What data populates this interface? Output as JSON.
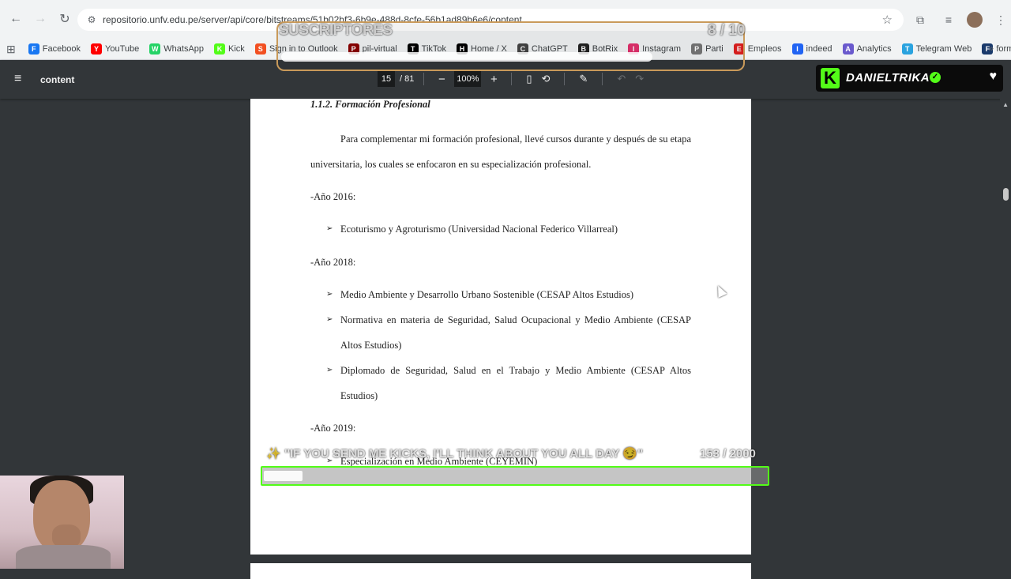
{
  "browser": {
    "url": "repositorio.unfv.edu.pe/server/api/core/bitstreams/51b02bf3-6b9e-488d-8cfe-56b1ad89b6e6/content"
  },
  "bookmarks": [
    {
      "label": "Facebook",
      "icon": "facebook-icon",
      "color": "#1877f2"
    },
    {
      "label": "YouTube",
      "icon": "youtube-icon",
      "color": "#ff0000"
    },
    {
      "label": "WhatsApp",
      "icon": "whatsapp-icon",
      "color": "#25d366"
    },
    {
      "label": "Kick",
      "icon": "kick-icon",
      "color": "#53fc18"
    },
    {
      "label": "Sign in to Outlook",
      "icon": "microsoft-icon",
      "color": "#f25022"
    },
    {
      "label": "pil-virtual",
      "icon": "pil-icon",
      "color": "#8b0000"
    },
    {
      "label": "TikTok",
      "icon": "tiktok-icon",
      "color": "#000000"
    },
    {
      "label": "Home / X",
      "icon": "x-icon",
      "color": "#000000"
    },
    {
      "label": "ChatGPT",
      "icon": "chatgpt-icon",
      "color": "#444444"
    },
    {
      "label": "BotRix",
      "icon": "botrix-icon",
      "color": "#222222"
    },
    {
      "label": "Instagram",
      "icon": "instagram-icon",
      "color": "#e1306c"
    },
    {
      "label": "Parti",
      "icon": "parti-icon",
      "color": "#777777"
    },
    {
      "label": "Empleos",
      "icon": "empleos-icon",
      "color": "#e02020"
    },
    {
      "label": "indeed",
      "icon": "indeed-icon",
      "color": "#2164f3"
    },
    {
      "label": "Analytics",
      "icon": "analytics-icon",
      "color": "#6a5acd"
    },
    {
      "label": "Telegram Web",
      "icon": "telegram-icon",
      "color": "#2aa3df"
    },
    {
      "label": "formate.pe",
      "icon": "formate-icon",
      "color": "#1a3a6b"
    }
  ],
  "viewer": {
    "title": "content",
    "page_current": "15",
    "page_total": "/ 81",
    "zoom": "100%"
  },
  "document": {
    "heading": "1.1.2. Formación Profesional",
    "intro": "Para complementar mi formación profesional, llevé cursos durante y después de su etapa universitaria, los cuales se enfocaron en su especialización profesional.",
    "year_2016": "-Año 2016:",
    "b2016_1": "Ecoturismo y Agroturismo (Universidad Nacional Federico Villarreal)",
    "year_2018": "-Año 2018:",
    "b2018_1": "Medio Ambiente y Desarrollo Urbano Sostenible (CESAP Altos Estudios)",
    "b2018_2": "Normativa en materia de Seguridad, Salud Ocupacional y Medio Ambiente (CESAP Altos Estudios)",
    "b2018_3": "Diplomado de Seguridad, Salud en el Trabajo y Medio Ambiente (CESAP Altos Estudios)",
    "year_2019": "-Año 2019:",
    "b2019_1": "Especialización en Medio Ambiente (CEYEMIN)"
  },
  "overlay": {
    "subs_label": "SUSCRIPTORES",
    "subs_count": "8 / 10",
    "subs_progress": 0.8,
    "streamer": "DANIELTRIKA",
    "goal_text": "\"IF YOU SEND ME KICKS, I'LL THINK ABOUT YOU ALL DAY 😏\"",
    "goal_count": "153 / 2000",
    "goal_progress": 0.0765,
    "kick_color": "#53fc18"
  }
}
